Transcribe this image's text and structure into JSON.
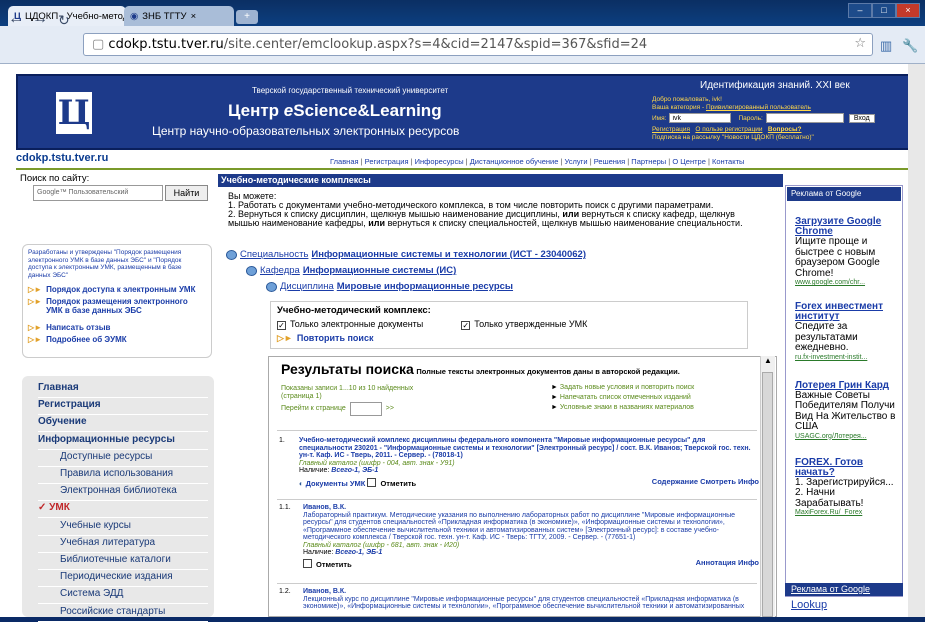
{
  "browser": {
    "tabs": [
      {
        "label": "ЦДОКП - Учебно-методи"
      },
      {
        "label": "ЗНБ ТГТУ"
      }
    ],
    "url": "cdokp.tstu.tver.ru/site.center/emclookup.aspx?s=4&cid=2147&spid=367&sfid=24",
    "url_domain": "cdokp.tstu.tver.ru",
    "url_rest": "/site.center/emclookup.aspx?s=4&cid=2147&spid=367&sfid=24"
  },
  "header": {
    "university": "Тверской государственный технический университет",
    "center_prefix": "Центр ",
    "center_e": "e",
    "center_suffix": "Science&Learning",
    "subtitle": "Центр научно-образовательных электронных ресурсов",
    "ident": "Идентификация знаний. XXI век",
    "welcome": "Добро пожаловать, ivk!",
    "category_label": "Ваша категория - ",
    "category_link": "Привилегированный пользователь",
    "login_label": "Имя:",
    "login_value": "ivk",
    "password_label": "Пароль:",
    "enter_button": "Вход",
    "register_link": "Регистрация",
    "benefit_link": "О пользе регистрации",
    "questions_link": "Вопросы?",
    "subscribe_link": "Подписка на рассылку \"Новости ЦДОКП (бесплатно)\""
  },
  "site": {
    "name": "cdokp.tstu.tver.ru",
    "topnav": [
      "Главная",
      "Регистрация",
      "Инфоресурсы",
      "Дистанционное обучение",
      "Услуги",
      "Решения",
      "Партнеры",
      "О Центре",
      "Контакты"
    ]
  },
  "left": {
    "search_label": "Поиск по сайту:",
    "search_placeholder": "Google™ Пользовательский",
    "search_button": "Найти",
    "info_text": "Разработаны и утверждены \"Порядок размещения электронного УМК в базе данных ЭБС\" и \"Порядок доступа к электронным УМК, размещенным в базе данных ЭБС\"",
    "info_links": [
      "Порядок доступа к электронным УМК",
      "Порядок размещения электронного УМК в базе данных ЭБС",
      "Написать отзыв",
      "Подробнее об ЭУМК"
    ],
    "menu": [
      {
        "label": "Главная",
        "level": 1
      },
      {
        "label": "Регистрация",
        "level": 1
      },
      {
        "label": "Обучение",
        "level": 1
      },
      {
        "label": "Информационные ресурсы",
        "level": 1
      },
      {
        "label": "Доступные ресурсы",
        "level": 2
      },
      {
        "label": "Правила использования",
        "level": 2
      },
      {
        "label": "Электронная библиотека",
        "level": 2
      },
      {
        "label": "УМК",
        "level": 1,
        "active": true
      },
      {
        "label": "Учебные курсы",
        "level": 2
      },
      {
        "label": "Учебная литература",
        "level": 2
      },
      {
        "label": "Библиотечные каталоги",
        "level": 2
      },
      {
        "label": "Периодические издания",
        "level": 2
      },
      {
        "label": "Система ЭДД",
        "level": 2
      },
      {
        "label": "Российские стандарты",
        "level": 2
      }
    ]
  },
  "content": {
    "section_title": "Учебно-методические комплексы",
    "intro_head": "Вы можете:",
    "intro_1": "1. Работать с документами учебно-методического комплекса, в том числе повторить поиск с другими параметрами.",
    "intro_2a": "2. Вернуться к списку дисциплин, щелкнув мышью наименование дисциплины, ",
    "intro_or": "или",
    "intro_2b": " вернуться к списку кафедр, щелкнув мышью наименование кафедры, ",
    "intro_2c": " вернуться к списку специальностей, щелкнув мышью наименование специальности.",
    "crumb_spec_label": "Специальность",
    "crumb_spec_value": "Информационные системы и технологии (ИСТ - 23040062)",
    "crumb_kaf_label": "Кафедра",
    "crumb_kaf_value": "Информационные системы (ИС)",
    "crumb_disc_label": "Дисциплина",
    "crumb_disc_value": "Мировые информационные ресурсы",
    "umk_title": "Учебно-методический комплекс:",
    "umk_opt1": "Только электронные документы",
    "umk_opt2": "Только утвержденные УМК",
    "repeat_search": "Повторить поиск"
  },
  "results": {
    "title": "Результаты поиска",
    "subtitle": "Полные тексты электронных документов даны в авторской редакции.",
    "shown": "Показаны записи 1...10 из 10 найденных",
    "page": "(страница 1)",
    "goto_label": "Перейти к странице",
    "goto_btn": ">>",
    "actions": [
      "Задать новые условия и повторить поиск",
      "Напечатать список отмеченных изданий",
      "Условные знаки в названиях материалов"
    ],
    "items": [
      {
        "num": "1.",
        "title": "Учебно-методический комплекс дисциплины федерального компонента \"Мировые информационные ресурсы\" для специальности 230201 - \"Информационные системы и технологии\" [Электронный ресурс] / сост. В.К. Иванов; Тверской гос. техн. ун-т. Каф. ИС - Тверь, 2011. - Сервер. - (78018-1)",
        "catalog": "Главный каталог (шифр - 004, авт. знак - У91)",
        "avail": "Наличие: ",
        "avail_v": "Всего-1, ЭБ-1",
        "docs": "Документы УМК",
        "mark": "Отметить",
        "links": "Содержание  Смотреть  Инфо"
      },
      {
        "num": "1.1.",
        "author": "Иванов, В.К.",
        "title": "Лабораторный практикум. Методические указания по выполнению лабораторных работ по дисциплине \"Мировые информационные ресурсы\" для студентов специальностей «Прикладная информатика (в экономике)», «Информационные системы и технологии», «Программное обеспечение вычислительной техники и автоматизированных систем» [Электронный ресурс]: в составе учебно-методического комплекса / Тверской гос. техн. ун-т. Каф. ИС - Тверь: ТГТУ, 2009. - Сервер. - (77651-1)",
        "catalog": "Главный каталог (шифр - 681, авт. знак - И20)",
        "avail": "Наличие: ",
        "avail_v": "Всего-1, ЭБ-1",
        "mark": "Отметить",
        "links": "Аннотация  Инфо"
      },
      {
        "num": "1.2.",
        "author": "Иванов, В.К.",
        "title": "Лекционный курс по дисциплине \"Мировые информационные ресурсы\" для студентов специальностей «Прикладная информатика (в экономике)», «Информационные системы и технологии», «Программное обеспечение вычислительной техники и автоматизированных"
      }
    ]
  },
  "ads": {
    "header": "Реклама от Google",
    "items": [
      {
        "title": "Загрузите Google Chrome",
        "body": "Ищите проще и быстрее с новым браузером Google Chrome!",
        "url": "www.google.com/chr..."
      },
      {
        "title": "Forex инвестмент институт",
        "body": "Спедите за результатами ежедневно.",
        "url": "ru.fx-investment-instit..."
      },
      {
        "title": "Лотерея Грин Кард",
        "body": "Важные Советы Победителям Получи Вид На Жительство в США",
        "url": "USAGC.org/Лотерея..."
      },
      {
        "title": "FOREX. Готов начать?",
        "body": "1. Зарегистрируйся... 2. Начни Зарабатывать!",
        "url": "MaxiForex.Ru/_Forex"
      }
    ],
    "footer_header": "Реклама от Google",
    "lookup": "Lookup"
  }
}
